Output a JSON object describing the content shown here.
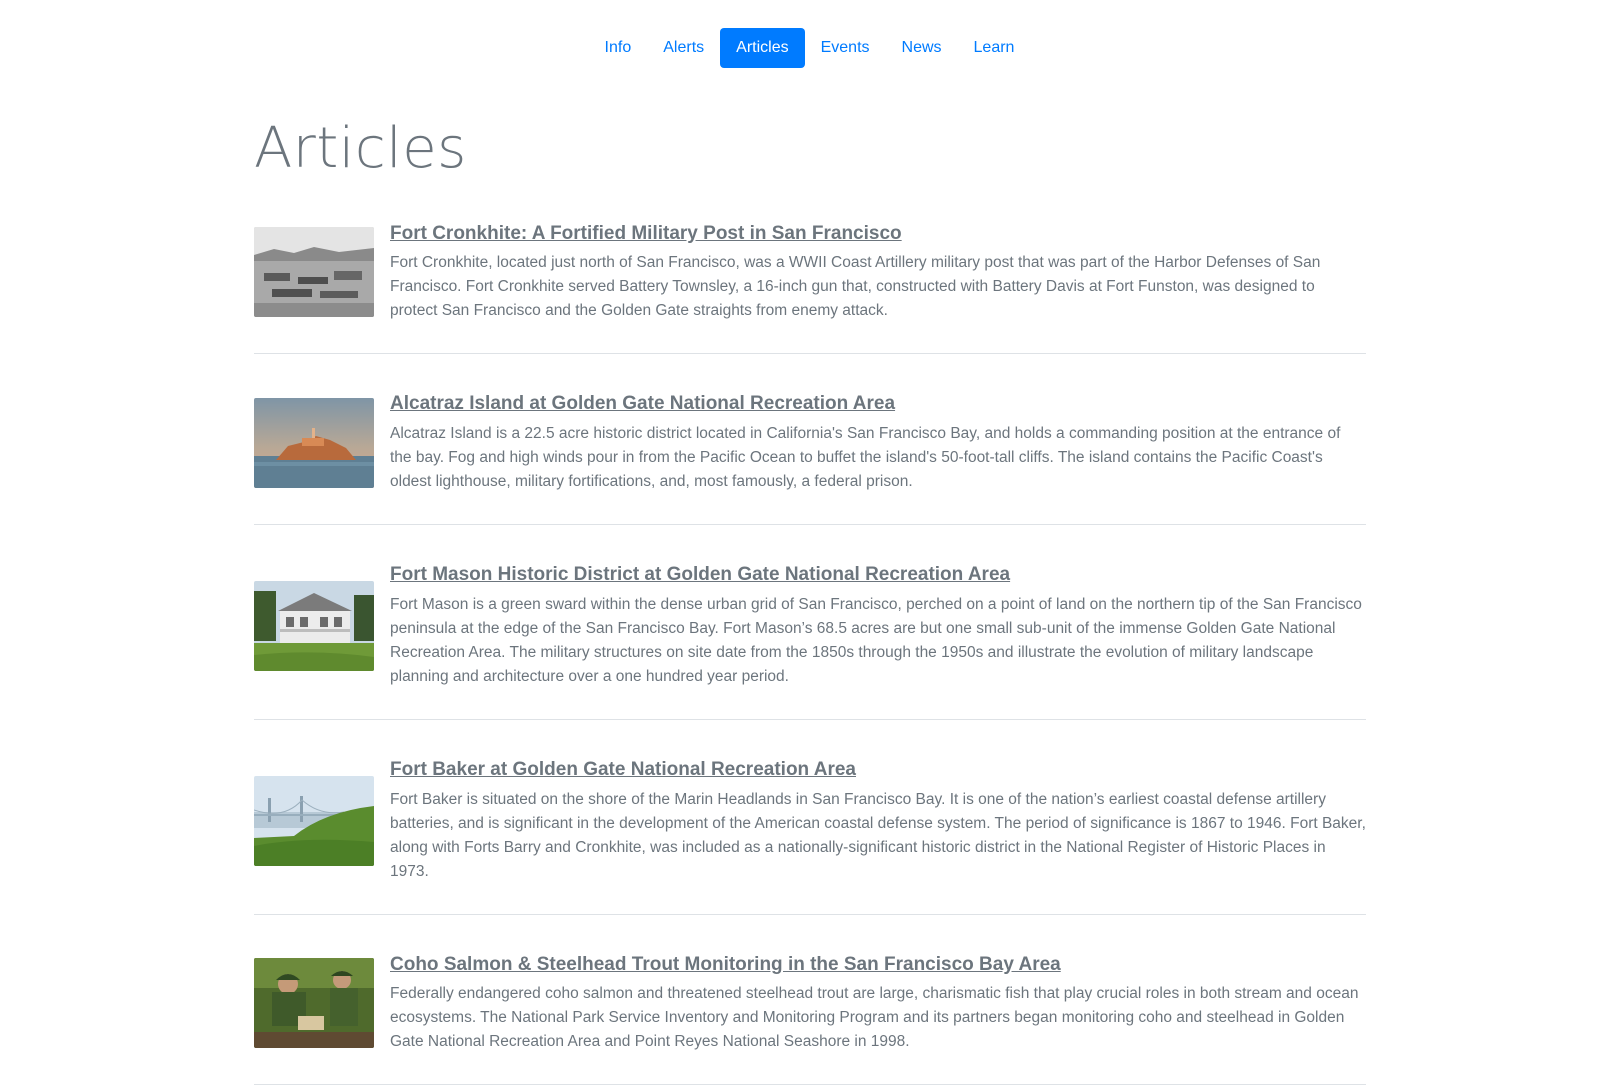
{
  "nav": {
    "items": [
      {
        "label": "Info",
        "active": false
      },
      {
        "label": "Alerts",
        "active": false
      },
      {
        "label": "Articles",
        "active": true
      },
      {
        "label": "Events",
        "active": false
      },
      {
        "label": "News",
        "active": false
      },
      {
        "label": "Learn",
        "active": false
      }
    ]
  },
  "page": {
    "title": "Articles"
  },
  "articles": [
    {
      "title": "Fort Cronkhite: A Fortified Military Post in San Francisco",
      "text": "Fort Cronkhite, located just north of San Francisco, was a WWII Coast Artillery military post that was part of the Harbor Defenses of San Francisco. Fort Cronkhite served Battery Townsley, a 16-inch gun that, constructed with Battery Davis at Fort Funston, was designed to protect San Francisco and the Golden Gate straights from enemy attack.",
      "image": "black-and-white-military-post-photo"
    },
    {
      "title": "Alcatraz Island at Golden Gate National Recreation Area",
      "text": "Alcatraz Island is a 22.5 acre historic district located in California's San Francisco Bay, and holds a commanding position at the entrance of the bay. Fog and high winds pour in from the Pacific Ocean to buffet the island's 50-foot-tall cliffs. The island contains the Pacific Coast's oldest lighthouse, military fortifications, and, most famously, a federal prison.",
      "image": "alcatraz-island-sunset-photo"
    },
    {
      "title": "Fort Mason Historic District at Golden Gate National Recreation Area",
      "text": "Fort Mason is a green sward within the dense urban grid of San Francisco, perched on a point of land on the northern tip of the San Francisco peninsula at the edge of the San Francisco Bay. Fort Mason’s 68.5 acres are but one small sub-unit of the immense Golden Gate National Recreation Area. The military structures on site date from the 1850s through the 1950s and illustrate the evolution of military landscape planning and architecture over a one hundred year period.",
      "image": "white-house-lawn-photo"
    },
    {
      "title": "Fort Baker at Golden Gate National Recreation Area",
      "text": "Fort Baker is situated on the shore of the Marin Headlands in San Francisco Bay. It is one of the nation’s earliest coastal defense artillery batteries, and is significant in the development of the American coastal defense system. The period of significance is 1867 to 1946. Fort Baker, along with Forts Barry and Cronkhite, was included as a nationally-significant historic district in the National Register of Historic Places in 1973.",
      "image": "golden-gate-bridge-hillside-photo"
    },
    {
      "title": "Coho Salmon & Steelhead Trout Monitoring in the San Francisco Bay Area",
      "text": "Federally endangered coho salmon and threatened steelhead trout are large, charismatic fish that play crucial roles in both stream and ocean ecosystems. The National Park Service Inventory and Monitoring Program and its partners began monitoring coho and steelhead in Golden Gate National Recreation Area and Point Reyes National Seashore in 1998.",
      "image": "rangers-monitoring-fish-photo"
    }
  ]
}
